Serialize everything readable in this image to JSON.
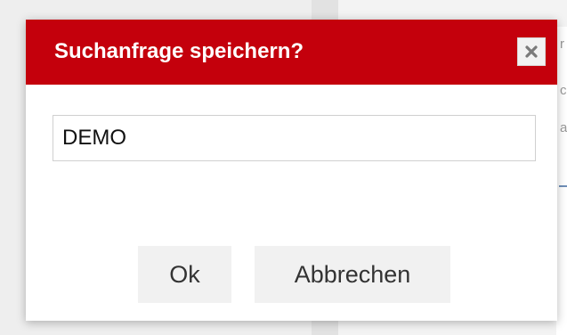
{
  "background": {
    "glyphs": [
      "r",
      "c",
      "a"
    ]
  },
  "dialog": {
    "title": "Suchanfrage speichern?",
    "close_icon": "close-x-icon",
    "name_input": {
      "value": "DEMO",
      "placeholder": ""
    },
    "ok_label": "Ok",
    "cancel_label": "Abbrechen"
  },
  "colors": {
    "header": "#c4000c",
    "header_text": "#ffffff",
    "button_bg": "#f1f1f1"
  }
}
